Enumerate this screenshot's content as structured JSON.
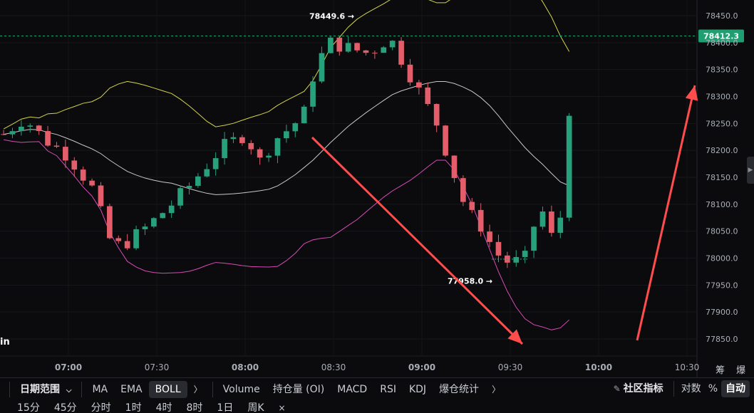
{
  "colors": {
    "background": "#0b0b0d",
    "up": "#26a17b",
    "down": "#e35d6a",
    "upper_band": "#d4d44a",
    "middle_band": "#c8c8c8",
    "lower_band": "#d64bb7",
    "price_badge": "#1f9e72",
    "arrow": "#ff4d4d"
  },
  "chart_data": {
    "type": "candlestick",
    "indicator": "BOLL",
    "y_ticks": [
      "78450.0",
      "78400.0",
      "78350.0",
      "78300.0",
      "78250.0",
      "78200.0",
      "78150.0",
      "78100.0",
      "78050.0",
      "78000.0",
      "77950.0",
      "77900.0",
      "77850.0"
    ],
    "x_ticks": [
      "07:00",
      "07:30",
      "08:00",
      "08:30",
      "09:00",
      "09:30",
      "10:00",
      "10:30"
    ],
    "ylim": [
      77820,
      78475
    ],
    "current_price": "78412.3",
    "annotations": {
      "high": "78449.6 →",
      "low": "77958.0 →"
    },
    "approx_close_path": [
      [
        "06:38",
        78230
      ],
      [
        "06:45",
        78260
      ],
      [
        "06:52",
        78220
      ],
      [
        "07:00",
        78190
      ],
      [
        "07:08",
        78130
      ],
      [
        "07:15",
        78020
      ],
      [
        "07:20",
        78030
      ],
      [
        "07:27",
        78060
      ],
      [
        "07:35",
        78100
      ],
      [
        "07:42",
        78140
      ],
      [
        "07:52",
        78205
      ],
      [
        "08:00",
        78230
      ],
      [
        "08:05",
        78180
      ],
      [
        "08:10",
        78220
      ],
      [
        "08:16",
        78245
      ],
      [
        "08:20",
        78270
      ],
      [
        "08:24",
        78360
      ],
      [
        "08:29",
        78400
      ],
      [
        "08:35",
        78390
      ],
      [
        "08:42",
        78380
      ],
      [
        "08:49",
        78410
      ],
      [
        "08:55",
        78350
      ],
      [
        "09:00",
        78300
      ],
      [
        "09:05",
        78250
      ],
      [
        "09:10",
        78170
      ],
      [
        "09:15",
        78090
      ],
      [
        "09:20",
        78060
      ],
      [
        "09:25",
        78010
      ],
      [
        "09:30",
        77990
      ],
      [
        "09:35",
        78000
      ],
      [
        "09:40",
        78100
      ],
      [
        "09:46",
        78010
      ],
      [
        "09:52",
        78410
      ]
    ]
  },
  "side_labels": {
    "unit_glyphs": "筹 爆",
    "left_edge": "in"
  },
  "toolbar": {
    "left_stub": "",
    "date_range": "日期范围",
    "indicators": [
      "MA",
      "EMA",
      "BOLL"
    ],
    "sub_indicators": [
      "Volume",
      "持仓量 (OI)",
      "MACD",
      "RSI",
      "KDJ",
      "爆仓统计"
    ],
    "community": "社区指标",
    "log": "对数",
    "percent": "%",
    "auto": "自动"
  },
  "intervals": [
    "15分",
    "45分",
    "分时",
    "1时",
    "4时",
    "8时",
    "1日",
    "周K",
    "×"
  ]
}
